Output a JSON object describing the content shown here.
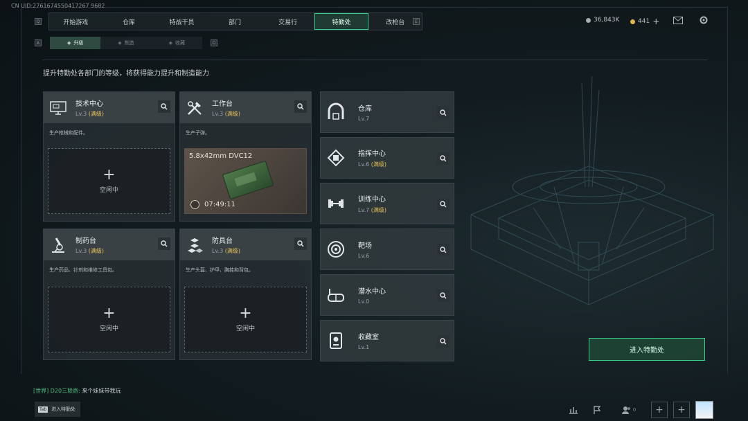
{
  "uid": "CN UID:2761674550417267 9682",
  "top_nav": {
    "left_key": "Q",
    "right_key": "E",
    "tabs": [
      "开始游戏",
      "仓库",
      "特战干员",
      "部门",
      "交易行",
      "特勤处",
      "改枪台"
    ],
    "active_index": 5
  },
  "sub_nav": {
    "left_key": "A",
    "right_key": "D",
    "tabs": [
      "升级",
      "制造",
      "收藏"
    ],
    "active_index": 0
  },
  "currency": {
    "silver": "36,843K",
    "gold": "441",
    "gold_add": "+"
  },
  "subtitle": "提升特勤处各部门的等级，将获得能力提升和制造能力",
  "cards": [
    {
      "name": "技术中心",
      "level_prefix": "Lv.3",
      "level_suffix": "(满级)",
      "desc": "生产枪械和配件。",
      "status": "空闲中",
      "plus": "+"
    },
    {
      "name": "工作台",
      "level_prefix": "Lv.3",
      "level_suffix": "(满级)",
      "desc": "生产子弹。",
      "product": "5.8x42mm DVC12",
      "timer": "07:49:11"
    },
    {
      "name": "制药台",
      "level_prefix": "Lv.3",
      "level_suffix": "(满级)",
      "desc": "生产药品、针剂和维修工具包。",
      "status": "空闲中",
      "plus": "+"
    },
    {
      "name": "防具台",
      "level_prefix": "Lv.3",
      "level_suffix": "(满级)",
      "desc": "生产头盔、护甲、胸挂和背包。",
      "status": "空闲中",
      "plus": "+"
    }
  ],
  "facilities": [
    {
      "name": "仓库",
      "level": "Lv.7",
      "suffix": ""
    },
    {
      "name": "指挥中心",
      "level": "Lv.6",
      "suffix": "(满级)"
    },
    {
      "name": "训练中心",
      "level": "Lv.7",
      "suffix": "(满级)"
    },
    {
      "name": "靶场",
      "level": "Lv.6",
      "suffix": ""
    },
    {
      "name": "潜水中心",
      "level": "Lv.0",
      "suffix": ""
    },
    {
      "name": "收藏室",
      "level": "Lv.1",
      "suffix": ""
    }
  ],
  "enter_button": "进入特勤处",
  "chat": {
    "channel": "[世界]",
    "sender": "D20三联炮:",
    "message": "来个妹妹带我玩"
  },
  "tab_hint": {
    "key": "Tab",
    "label": "进入特勤处"
  },
  "friends_count": "0",
  "colors": {
    "accent": "#38d08a",
    "max_level": "#e8c25a",
    "chat_green": "#4fbf7e"
  },
  "icons": [
    "mail-icon",
    "settings-gear-icon",
    "chart-icon",
    "flag-icon",
    "friends-icon",
    "plus-icon",
    "search-icon"
  ]
}
